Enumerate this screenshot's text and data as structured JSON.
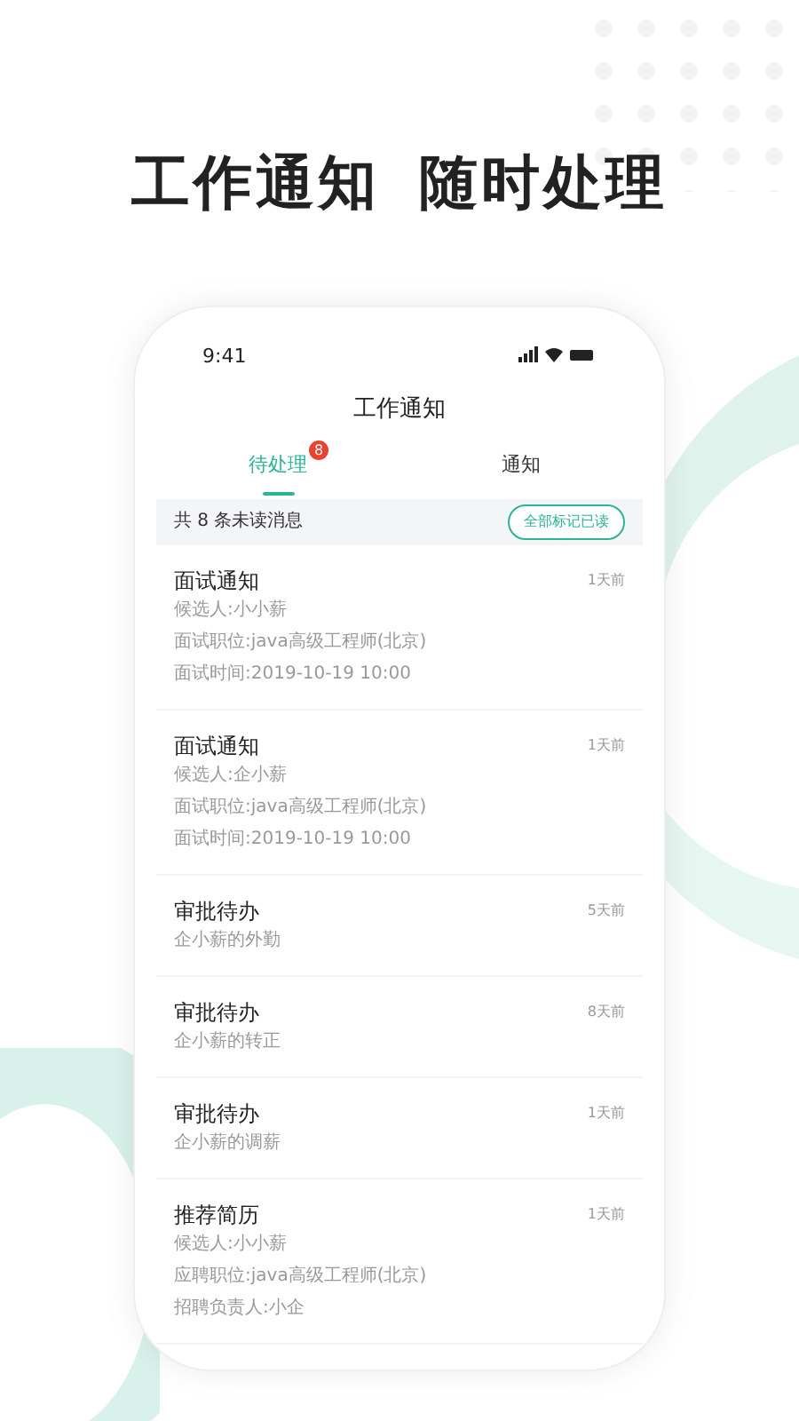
{
  "headline": {
    "part_1": "工作通知",
    "part_2": "随时处理"
  },
  "status_bar": {
    "time": "9:41"
  },
  "screen_title": "工作通知",
  "tabs": [
    {
      "label": "待处理",
      "selected": true,
      "badge": "8"
    },
    {
      "label": "通知",
      "selected": false
    }
  ],
  "summary": {
    "text": "共 8 条未读消息",
    "button": "全部标记已读"
  },
  "messages": [
    {
      "title": "面试通知",
      "time": "1天前",
      "lines": [
        "候选人:小小薪",
        "面试职位:java高级工程师(北京)",
        "面试时间:2019-10-19 10:00"
      ]
    },
    {
      "title": "面试通知",
      "time": "1天前",
      "lines": [
        "候选人:企小薪",
        "面试职位:java高级工程师(北京)",
        "面试时间:2019-10-19 10:00"
      ]
    },
    {
      "title": "审批待办",
      "time": "5天前",
      "lines": [
        "企小薪的外勤"
      ]
    },
    {
      "title": "审批待办",
      "time": "8天前",
      "lines": [
        "企小薪的转正"
      ]
    },
    {
      "title": "审批待办",
      "time": "1天前",
      "lines": [
        "企小薪的调薪"
      ]
    },
    {
      "title": "推荐简历",
      "time": "1天前",
      "lines": [
        "候选人:小小薪",
        "应聘职位:java高级工程师(北京)",
        "招聘负责人:小企"
      ]
    }
  ]
}
